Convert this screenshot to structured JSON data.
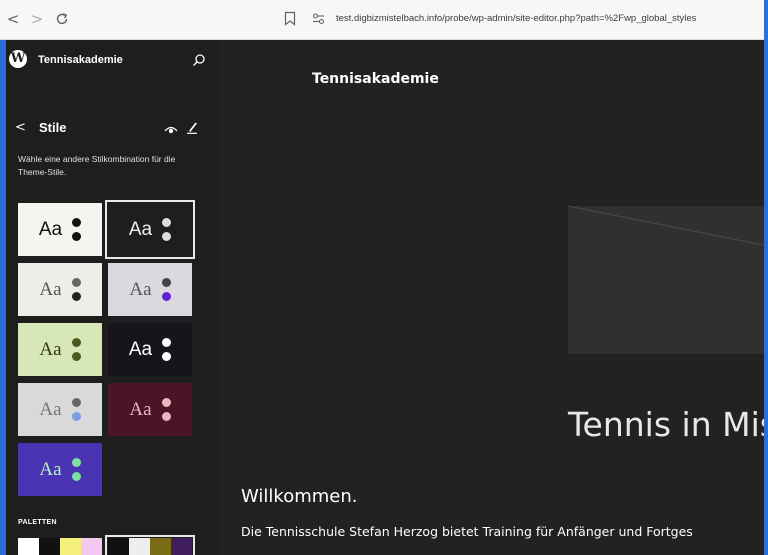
{
  "browser": {
    "url": "test.digbizmistelbach.info/probe/wp-admin/site-editor.php?path=%2Fwp_global_styles",
    "back_glyph": "<",
    "forward_glyph": ">",
    "reload_glyph": "C"
  },
  "sidebar": {
    "site_title": "Tennisakademie",
    "panel_title": "Stile",
    "back_glyph": "<",
    "description": "Wähle eine andere Stilkombination für die Theme-Stile.",
    "variations_aa": [
      "Aa",
      "Aa",
      "Aa",
      "Aa",
      "Aa",
      "Aa",
      "Aa",
      "Aa",
      "Aa"
    ],
    "palettes_label": "PALETTEN"
  },
  "canvas": {
    "site_title": "Tennisakademie",
    "hero_heading": "Tennis in Mis",
    "welcome": "Willkommen.",
    "intro": "Die Tennisschule Stefan Herzog bietet Training für Anfänger und Fortges"
  },
  "colors": {
    "accent": "#2b6ad9",
    "admin_background": "#1e1e1e"
  }
}
